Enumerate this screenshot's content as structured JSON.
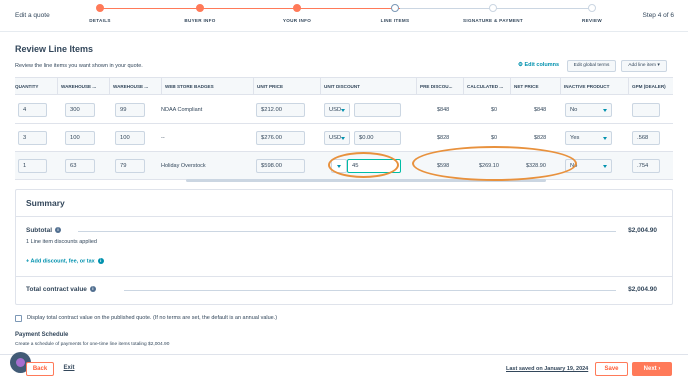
{
  "header": {
    "edit_label": "Edit a quote",
    "step_counter": "Step 4 of 6",
    "steps": [
      {
        "label": "DETAILS",
        "state": "done"
      },
      {
        "label": "BUYER INFO",
        "state": "done"
      },
      {
        "label": "YOUR INFO",
        "state": "done"
      },
      {
        "label": "LINE ITEMS",
        "state": "current"
      },
      {
        "label": "SIGNATURE & PAYMENT",
        "state": "todo"
      },
      {
        "label": "REVIEW",
        "state": "todo"
      }
    ]
  },
  "page": {
    "title": "Review Line Items",
    "subtitle": "Review the line items you want shown in your quote.",
    "edit_columns": "Edit columns",
    "edit_global_terms": "Edit global terms",
    "add_line_item": "Add line item"
  },
  "table": {
    "columns": [
      "QUANTITY",
      "WAREHOUSE ...",
      "WAREHOUSE ...",
      "WEB STORE BADGES",
      "UNIT PRICE",
      "UNIT DISCOUNT",
      "PRE DISCOU...",
      "CALCULATED ...",
      "NET PRICE",
      "INACTIVE PRODUCT",
      "GPM (DEALER)"
    ],
    "rows": [
      {
        "quantity": "4",
        "wh1": "300",
        "wh2": "99",
        "badge": "NDAA Compliant",
        "unit_price": "$212.00",
        "currency": "USD",
        "discount": "",
        "pre_discount": "$848",
        "calculated": "$0",
        "net_price": "$848",
        "inactive": "No",
        "gpm": ""
      },
      {
        "quantity": "3",
        "wh1": "100",
        "wh2": "100",
        "badge": "--",
        "unit_price": "$276.00",
        "currency": "USD",
        "discount": "$0.00",
        "pre_discount": "$828",
        "calculated": "$0",
        "net_price": "$828",
        "inactive": "Yes",
        "gpm": ".568"
      },
      {
        "quantity": "1",
        "wh1": "63",
        "wh2": "79",
        "badge": "Holiday Overstock",
        "unit_price": "$598.00",
        "currency": "",
        "discount": "45",
        "pre_discount": "$598",
        "calculated": "$269.10",
        "net_price": "$328.90",
        "inactive": "No",
        "gpm": ".754"
      }
    ]
  },
  "summary": {
    "title": "Summary",
    "subtotal_label": "Subtotal",
    "subtotal_value": "$2,004.90",
    "discounts_note": "1   Line item discounts applied",
    "add_link": "+ Add discount, fee, or tax",
    "total_label": "Total contract value",
    "total_value": "$2,004.90"
  },
  "options": {
    "display_total_label": "Display total contract value on the published quote. (If no terms are set, the default is an annual value.)",
    "payment_schedule_title": "Payment Schedule",
    "payment_schedule_sub": "Create a schedule of payments for one-time line items totaling $2,004.90"
  },
  "footer": {
    "back": "Back",
    "exit": "Exit",
    "last_saved": "Last saved on January 19, 2024",
    "save": "Save",
    "next": "Next"
  },
  "colors": {
    "accent": "#ff7a59",
    "link": "#0091ae",
    "annotation": "#e8913d"
  }
}
